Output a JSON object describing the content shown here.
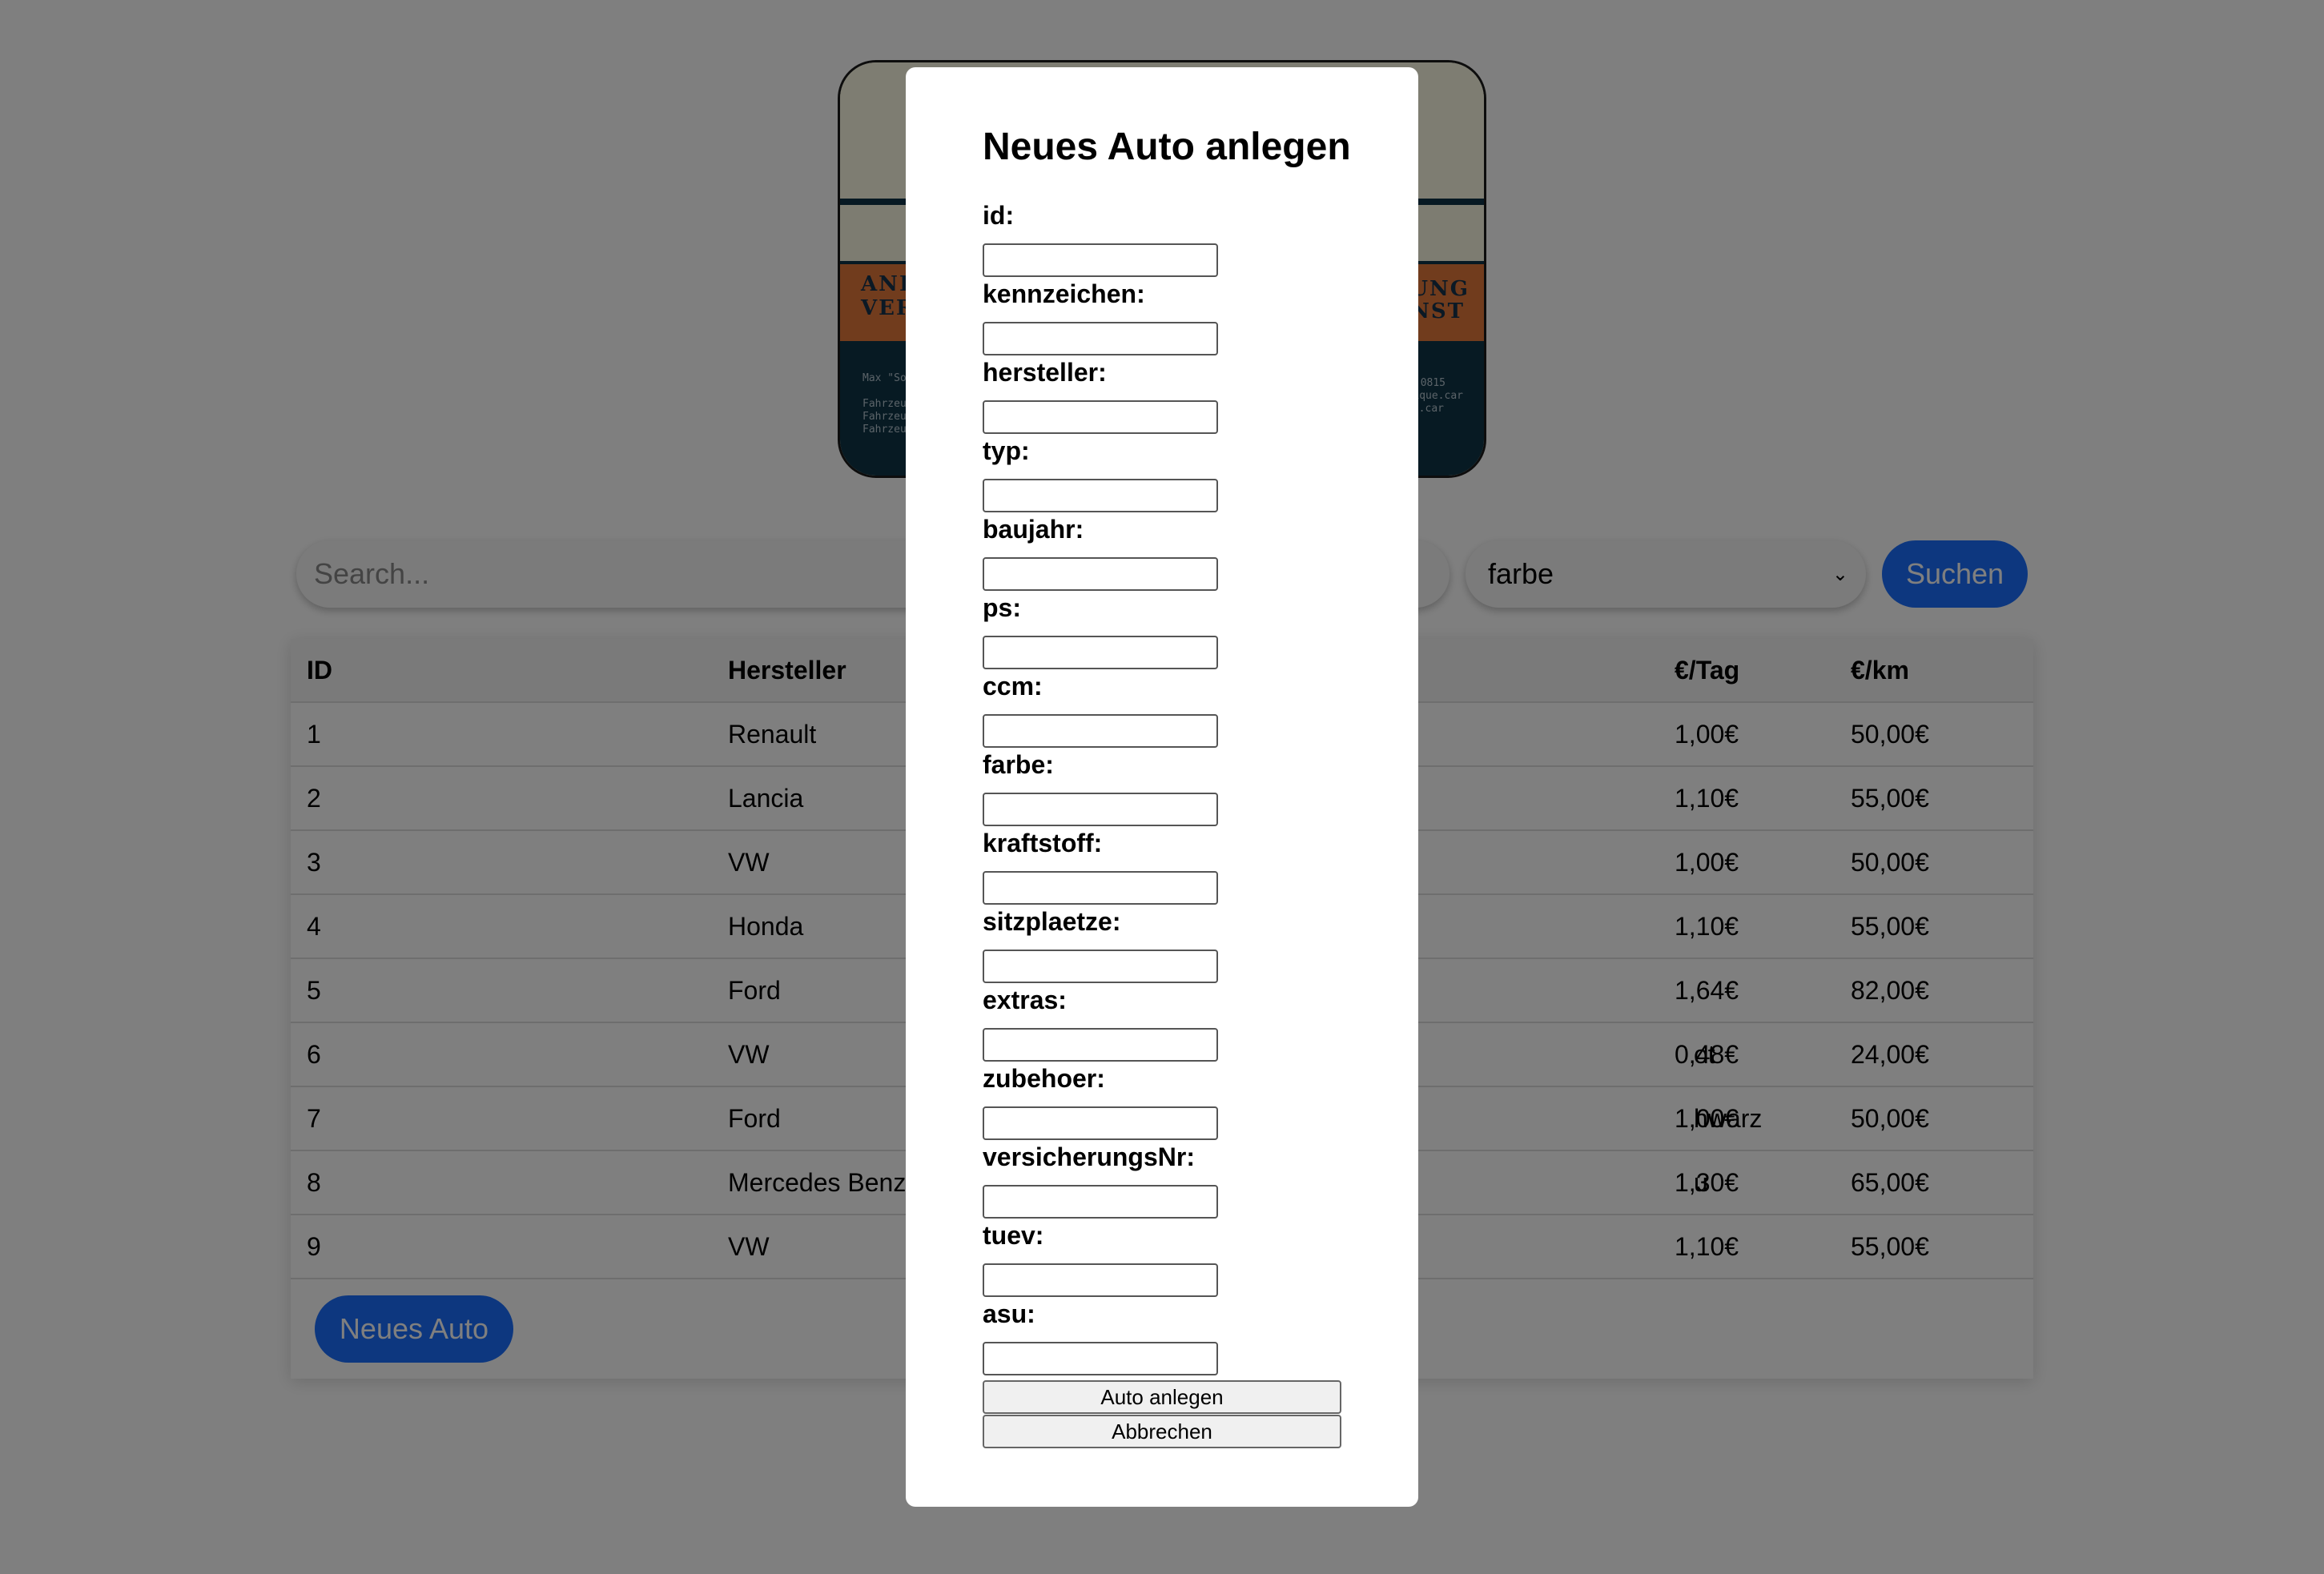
{
  "search": {
    "placeholder": "Search...",
    "filter_value": "farbe",
    "button_label": "Suchen"
  },
  "banner": {
    "left_text_1": "ANK",
    "left_text_2": "VER",
    "right_text_1": "TUNG",
    "right_text_2": "ENST",
    "small_left": [
      "Max \"So",
      "Fahrzeu",
      "Fahrzeu",
      "Fahrzeu"
    ],
    "small_right": [
      "0815",
      "ique.car",
      "e.car"
    ]
  },
  "table": {
    "headers": {
      "id": "ID",
      "hersteller": "Hersteller",
      "tag": "€/Tag",
      "km": "€/km"
    },
    "rows": [
      {
        "id": "1",
        "hersteller": "Renault",
        "extra": "",
        "tag": "1,00€",
        "km": "50,00€"
      },
      {
        "id": "2",
        "hersteller": "Lancia",
        "extra": "",
        "tag": "1,10€",
        "km": "55,00€"
      },
      {
        "id": "3",
        "hersteller": "VW",
        "extra": "",
        "tag": "1,00€",
        "km": "50,00€"
      },
      {
        "id": "4",
        "hersteller": "Honda",
        "extra": "",
        "tag": "1,10€",
        "km": "55,00€"
      },
      {
        "id": "5",
        "hersteller": "Ford",
        "extra": "",
        "tag": "1,64€",
        "km": "82,00€"
      },
      {
        "id": "6",
        "hersteller": "VW",
        "extra": "ot",
        "tag": "0,48€",
        "km": "24,00€"
      },
      {
        "id": "7",
        "hersteller": "Ford",
        "extra": "hwarz",
        "tag": "1,00€",
        "km": "50,00€"
      },
      {
        "id": "8",
        "hersteller": "Mercedes Benz",
        "extra": "u",
        "tag": "1,30€",
        "km": "65,00€"
      },
      {
        "id": "9",
        "hersteller": "VW",
        "extra": "",
        "tag": "1,10€",
        "km": "55,00€"
      }
    ],
    "new_button_label": "Neues Auto"
  },
  "modal": {
    "title": "Neues Auto anlegen",
    "fields": [
      {
        "label": "id:"
      },
      {
        "label": "kennzeichen:"
      },
      {
        "label": "hersteller:"
      },
      {
        "label": "typ:"
      },
      {
        "label": "baujahr:"
      },
      {
        "label": "ps:"
      },
      {
        "label": "ccm:"
      },
      {
        "label": "farbe:"
      },
      {
        "label": "kraftstoff:"
      },
      {
        "label": "sitzplaetze:"
      },
      {
        "label": "extras:"
      },
      {
        "label": "zubehoer:"
      },
      {
        "label": "versicherungsNr:"
      },
      {
        "label": "tuev:"
      },
      {
        "label": "asu:"
      }
    ],
    "submit_label": "Auto anlegen",
    "cancel_label": "Abbrechen"
  },
  "colors": {
    "accent": "#1a6fff",
    "overlay": "rgba(0,0,0,0.5)"
  }
}
